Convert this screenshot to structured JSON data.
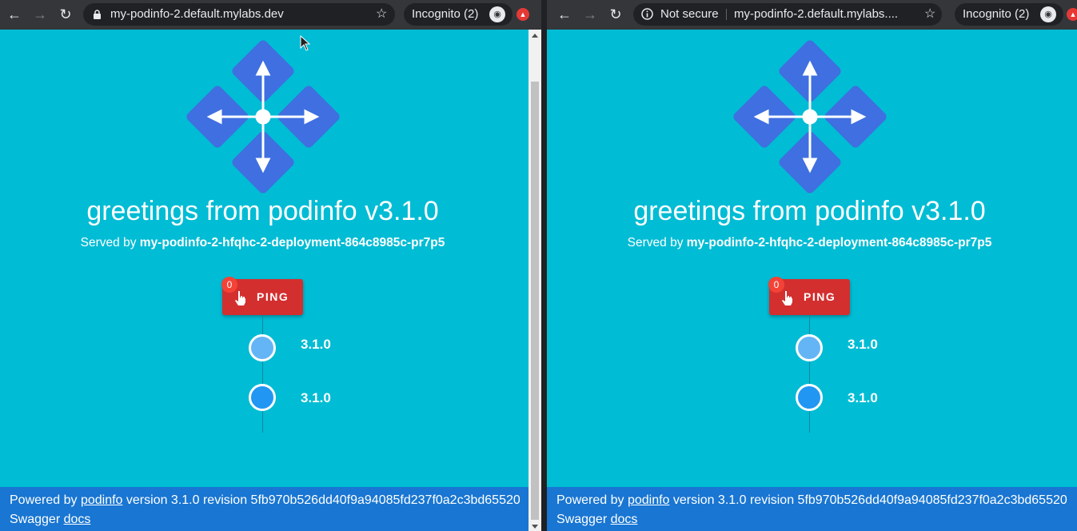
{
  "windows": [
    {
      "toolbar": {
        "url": "my-podinfo-2.default.mylabs.dev",
        "security_text": "",
        "incognito_label": "Incognito (2)"
      },
      "page": {
        "greeting": "greetings from podinfo v3.1.0",
        "served_by_prefix": "Served by",
        "served_by_host": "my-podinfo-2-hfqhc-2-deployment-864c8985c-pr7p5",
        "ping_label": "PING",
        "ping_count": "0",
        "timeline": [
          "3.1.0",
          "3.1.0"
        ],
        "footer_powered": "Powered by",
        "footer_podinfo_link": "podinfo",
        "footer_version_text": "version 3.1.0 revision 5fb970b526dd40f9a94085fd237f0a2c3bd65520",
        "footer_swagger": "Swagger",
        "footer_docs_link": "docs"
      }
    },
    {
      "toolbar": {
        "url": "my-podinfo-2.default.mylabs....",
        "security_text": "Not secure",
        "incognito_label": "Incognito (2)"
      },
      "page": {
        "greeting": "greetings from podinfo v3.1.0",
        "served_by_prefix": "Served by",
        "served_by_host": "my-podinfo-2-hfqhc-2-deployment-864c8985c-pr7p5",
        "ping_label": "PING",
        "ping_count": "0",
        "timeline": [
          "3.1.0",
          "3.1.0"
        ],
        "footer_powered": "Powered by",
        "footer_podinfo_link": "podinfo",
        "footer_version_text": "version 3.1.0 revision 5fb970b526dd40f9a94085fd237f0a2c3bd65520",
        "footer_swagger": "Swagger",
        "footer_docs_link": "docs"
      }
    }
  ],
  "icons": {
    "back": "arrow-left-icon",
    "forward": "arrow-right-icon",
    "reload": "reload-icon",
    "lock": "lock-icon",
    "info": "info-icon",
    "star": "star-icon",
    "incognito": "incognito-icon",
    "extension": "extension-icon",
    "logo": "podinfo-logo",
    "hand": "hand-pointer-icon"
  },
  "colors": {
    "page_bg": "#00bcd4",
    "footer_bg": "#1976d2",
    "ping_bg": "#d32f2f",
    "logo_blue": "#3f6fe0",
    "dot_light": "#64b5f6",
    "dot_dark": "#2196f3"
  }
}
